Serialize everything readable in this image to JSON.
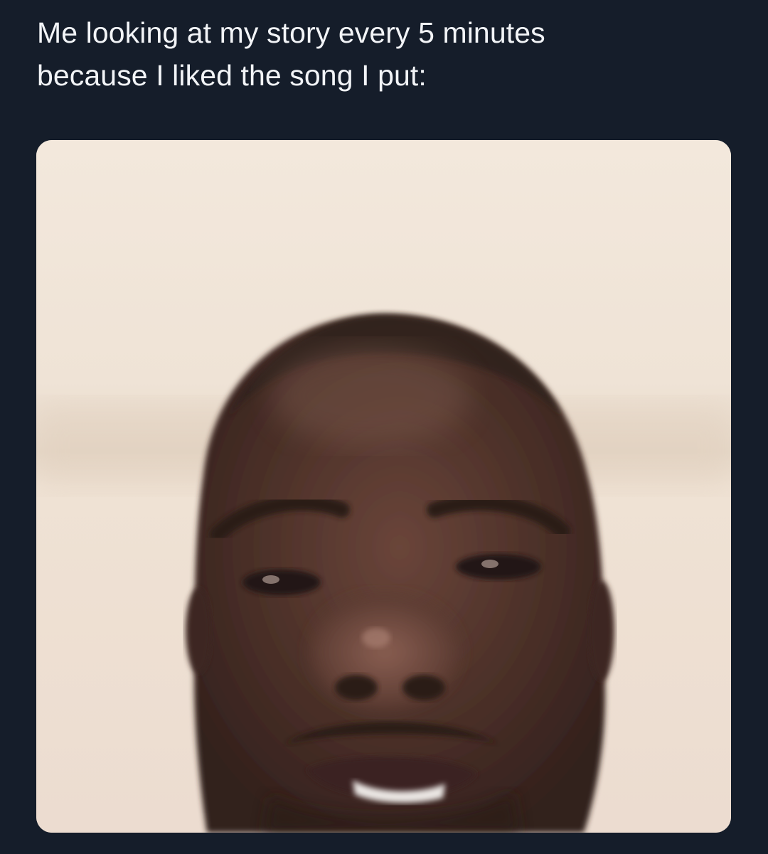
{
  "post": {
    "caption_line_1": "Me looking at my story every 5 minutes",
    "caption_line_2": "because I liked the song I put:"
  },
  "colors": {
    "background": "#151d2a",
    "caption_text": "#f2f4f7",
    "wall": "#efe2d4",
    "skin": "#4a3028"
  }
}
